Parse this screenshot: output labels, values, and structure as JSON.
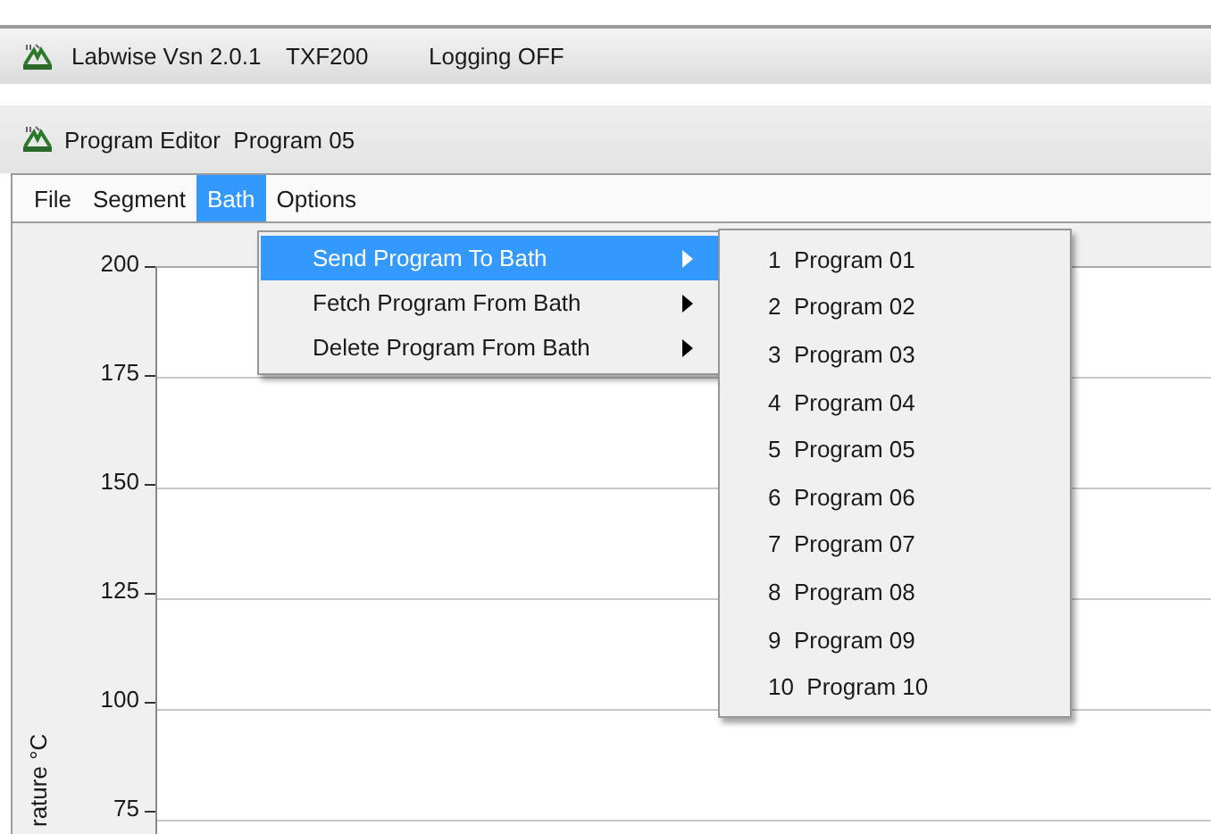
{
  "app_bar": {
    "title": "Labwise Vsn 2.0.1",
    "device": "TXF200",
    "logging": "Logging OFF"
  },
  "window": {
    "title": "Program Editor  Program 05"
  },
  "menu_bar": [
    {
      "label": "File",
      "selected": false
    },
    {
      "label": "Segment",
      "selected": false
    },
    {
      "label": "Bath",
      "selected": true
    },
    {
      "label": "Options",
      "selected": false
    }
  ],
  "bath_menu": [
    {
      "label": "Send Program To Bath",
      "selected": true
    },
    {
      "label": "Fetch Program From Bath",
      "selected": false
    },
    {
      "label": "Delete Program From Bath",
      "selected": false
    }
  ],
  "program_submenu": [
    {
      "number": "1",
      "label": "Program 01"
    },
    {
      "number": "2",
      "label": "Program 02"
    },
    {
      "number": "3",
      "label": "Program 03"
    },
    {
      "number": "4",
      "label": "Program 04"
    },
    {
      "number": "5",
      "label": "Program 05"
    },
    {
      "number": "6",
      "label": "Program 06"
    },
    {
      "number": "7",
      "label": "Program 07"
    },
    {
      "number": "8",
      "label": "Program 08"
    },
    {
      "number": "9",
      "label": "Program 09"
    },
    {
      "number": "10",
      "label": "Program 10"
    }
  ],
  "chart": {
    "axis_label": "rature °C",
    "y_ticks": [
      "200",
      "175",
      "150",
      "125",
      "100",
      "75"
    ]
  }
}
